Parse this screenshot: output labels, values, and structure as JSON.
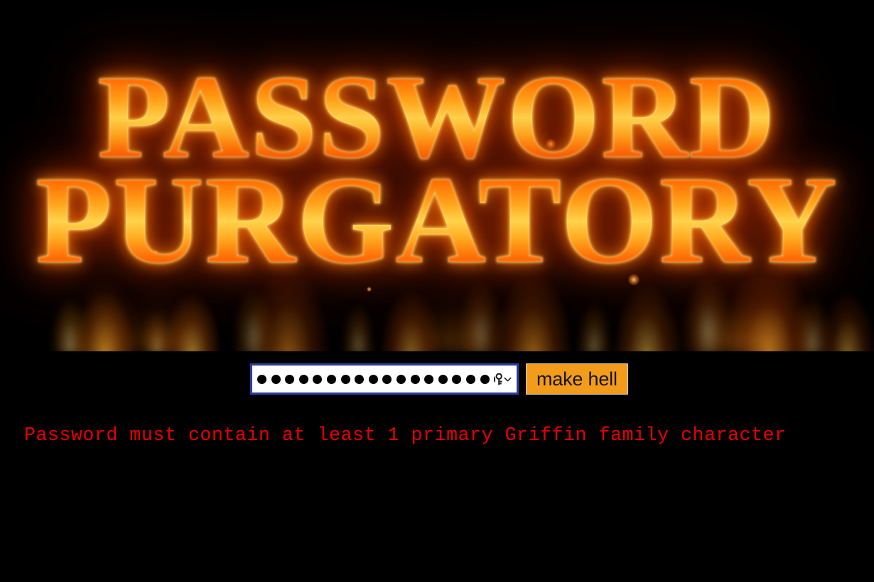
{
  "page": {
    "background_color": "#000000",
    "title_line_1": "PASSWORD",
    "title_line_2": "PURGATORY",
    "title_alt": "Password Purgatory - flaming fire text banner"
  },
  "form": {
    "password_input": {
      "name": "password",
      "type": "password",
      "masked_value": "●●●●●●●●●●●●●●●●●●●",
      "character_count": 19,
      "placeholder": "",
      "focused": true,
      "focus_border_color": "#2b3f9e"
    },
    "password_manager_icon": "key-icon",
    "password_manager_chevron": "chevron-down-icon",
    "submit_button": {
      "label": "make hell",
      "background_color": "#f39c1c",
      "text_color": "#141414"
    }
  },
  "validation": {
    "error_message": "Password must contain at least 1 primary Griffin family character",
    "error_color": "#e00000"
  },
  "colors": {
    "flame_core": "#ffd24a",
    "flame_mid": "#ff8a10",
    "flame_deep": "#e03a00",
    "accent_orange": "#f39c1c",
    "error_red": "#e00000",
    "focus_blue": "#2b3f9e",
    "background": "#000000"
  }
}
